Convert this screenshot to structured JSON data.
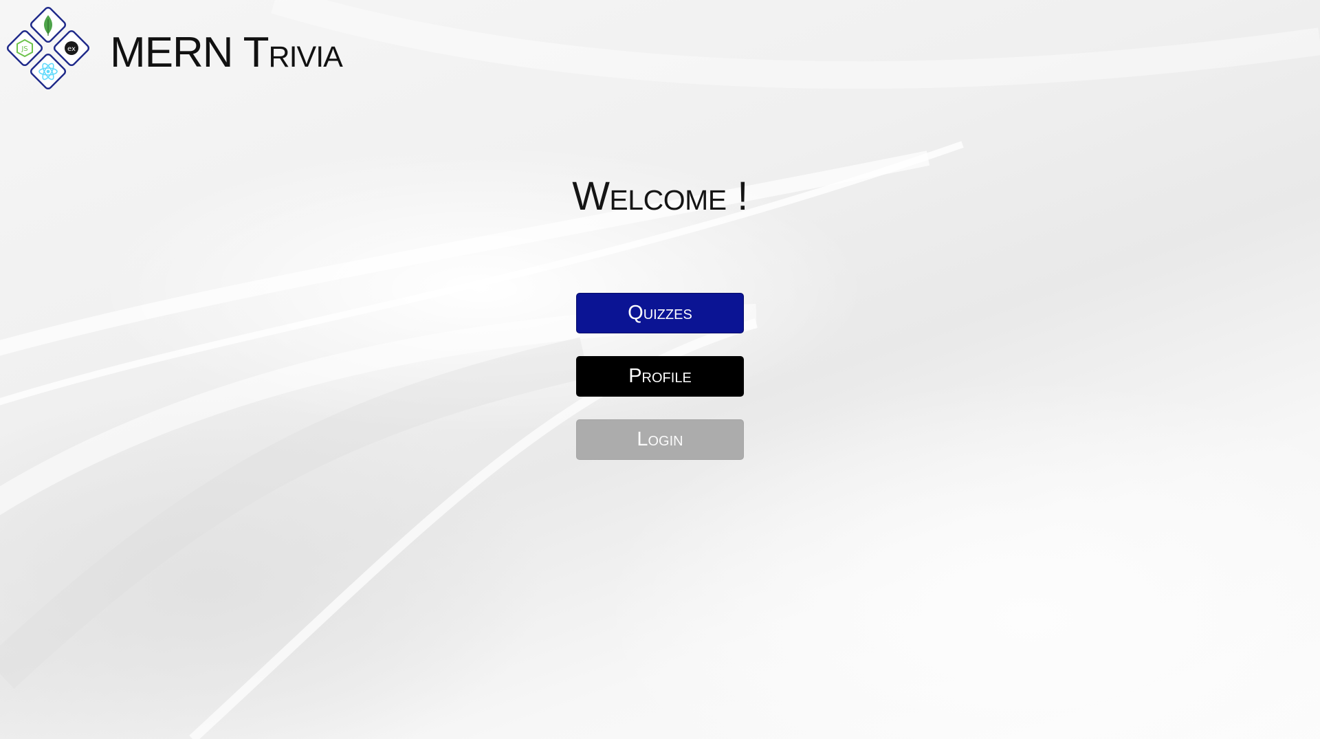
{
  "header": {
    "app_title": "MERN Trivia",
    "logo": {
      "icons": [
        "mongodb-leaf-icon",
        "express-icon",
        "nodejs-icon",
        "react-icon"
      ],
      "express_text": "ex",
      "node_text": "JS",
      "frame_color": "#1f2a8a"
    }
  },
  "main": {
    "welcome": "Welcome !",
    "buttons": {
      "quizzes": "Quizzes",
      "profile": "Profile",
      "login": "Login"
    }
  },
  "colors": {
    "quizzes_button": "#0b1494",
    "profile_button": "#000000",
    "login_button": "#acacac"
  }
}
